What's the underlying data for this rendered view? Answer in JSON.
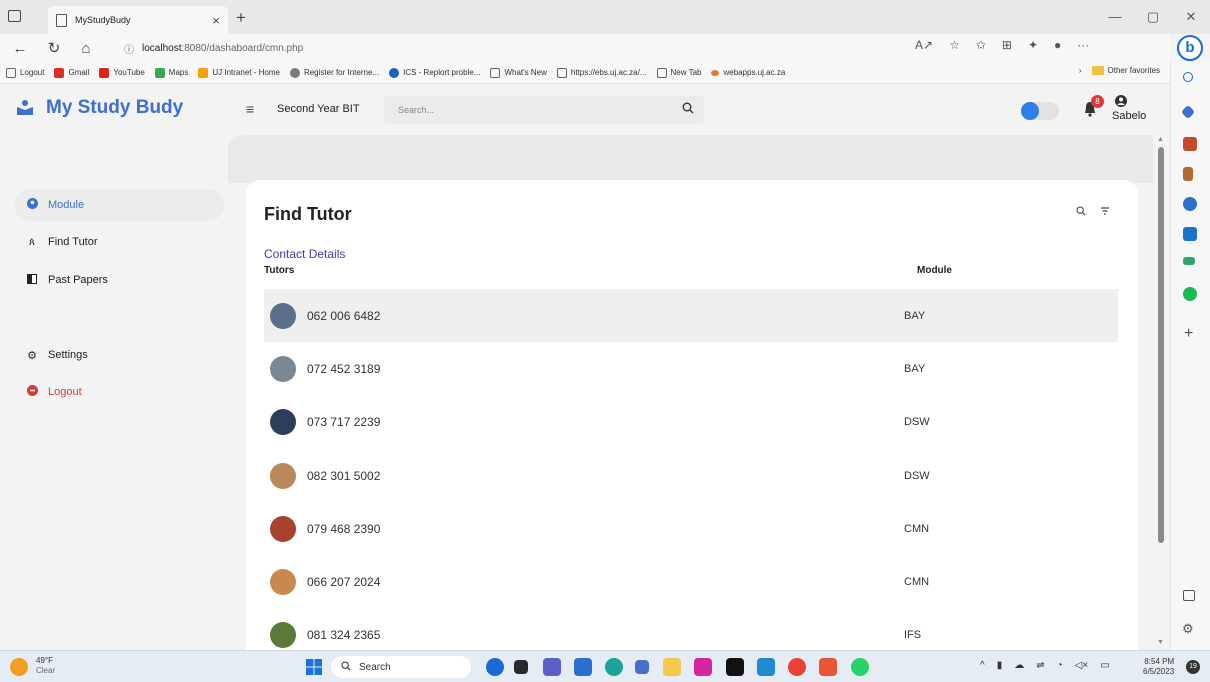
{
  "browser": {
    "tab_title": "MyStudyBudy",
    "url_host": "localhost",
    "url_path": ":8080/dashaboard/cmn.php",
    "favorites": [
      {
        "label": "Logout",
        "color": "#666666"
      },
      {
        "label": "Gmail",
        "color": "#d93025"
      },
      {
        "label": "YouTube",
        "color": "#e62117"
      },
      {
        "label": "Maps",
        "color": "#34a853"
      },
      {
        "label": "UJ Intranet - Home",
        "color": "#f4a300"
      },
      {
        "label": "Register for Interne...",
        "color": "#7a7a7a"
      },
      {
        "label": "ICS - Replort proble...",
        "color": "#1f5fbf"
      },
      {
        "label": "What's New",
        "color": "#666666"
      },
      {
        "label": "https://ebs.uj.ac.za/...",
        "color": "#666666"
      },
      {
        "label": "New Tab",
        "color": "#666666"
      },
      {
        "label": "webapps.uj.ac.za",
        "color": "#e07a2b"
      }
    ],
    "other_favorites": "Other favorites"
  },
  "app": {
    "brand": "My Study Budy",
    "brand_color": "#3c6fd0",
    "course": "Second Year BIT",
    "search_placeholder": "Search...",
    "notification_count": "8",
    "username": "Sabelo"
  },
  "sidebar": {
    "items": [
      {
        "label": "Module",
        "icon": "module-icon",
        "active": true
      },
      {
        "label": "Find Tutor",
        "icon": "find-tutor-icon"
      },
      {
        "label": "Past Papers",
        "icon": "past-papers-icon"
      },
      {
        "label": "Settings",
        "icon": "gear-icon"
      },
      {
        "label": "Logout",
        "icon": "logout-icon"
      }
    ]
  },
  "main": {
    "title": "Find Tutor",
    "section_label": "Contact Details",
    "columns": [
      "Tutors",
      "Module"
    ],
    "rows": [
      {
        "phone": "062 006 6482",
        "module": "BAY",
        "avatar_color": "#5a6f8a"
      },
      {
        "phone": "072 452 3189",
        "module": "BAY",
        "avatar_color": "#7a8794"
      },
      {
        "phone": "073 717 2239",
        "module": "DSW",
        "avatar_color": "#2c3e5c"
      },
      {
        "phone": "082 301 5002",
        "module": "DSW",
        "avatar_color": "#b8895a"
      },
      {
        "phone": "079 468 2390",
        "module": "CMN",
        "avatar_color": "#a8412e"
      },
      {
        "phone": "066 207 2024",
        "module": "CMN",
        "avatar_color": "#c78a4a"
      },
      {
        "phone": "081 324 2365",
        "module": "IFS",
        "avatar_color": "#5b7a3a"
      }
    ]
  },
  "taskbar": {
    "temperature": "49°F",
    "weather": "Clear",
    "search_label": "Search",
    "time": "8:54 PM",
    "date": "6/5/2023",
    "notification_count": "19"
  }
}
